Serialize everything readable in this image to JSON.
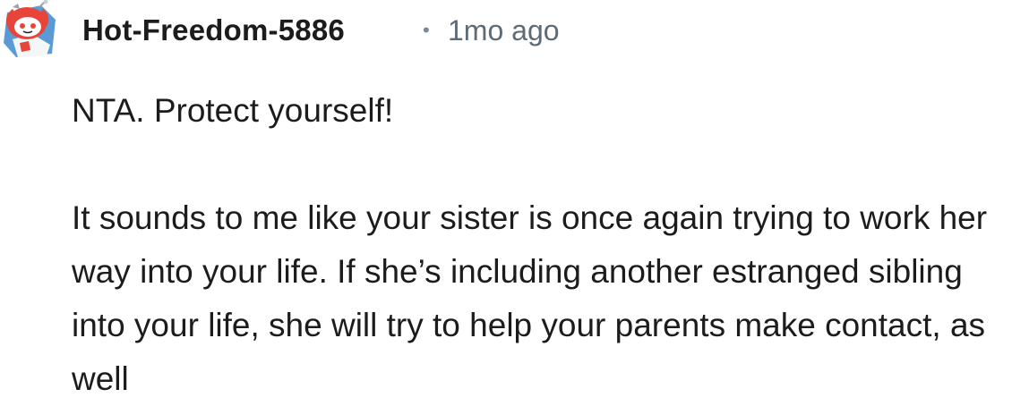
{
  "comment": {
    "author": "Hot-Freedom-5886",
    "separator": "•",
    "timestamp": "1mo ago",
    "paragraphs": [
      "NTA. Protect yourself!",
      "It sounds to me like your sister is once again trying to work her way into your life. If she’s including another estranged sibling into your life, she will try to help your parents make contact, as well"
    ]
  },
  "avatar": {
    "icon": "snoo-avatar-icon",
    "colors": {
      "background": "#5b9bd5",
      "accent": "#e8443a",
      "face": "#ffffff"
    }
  }
}
